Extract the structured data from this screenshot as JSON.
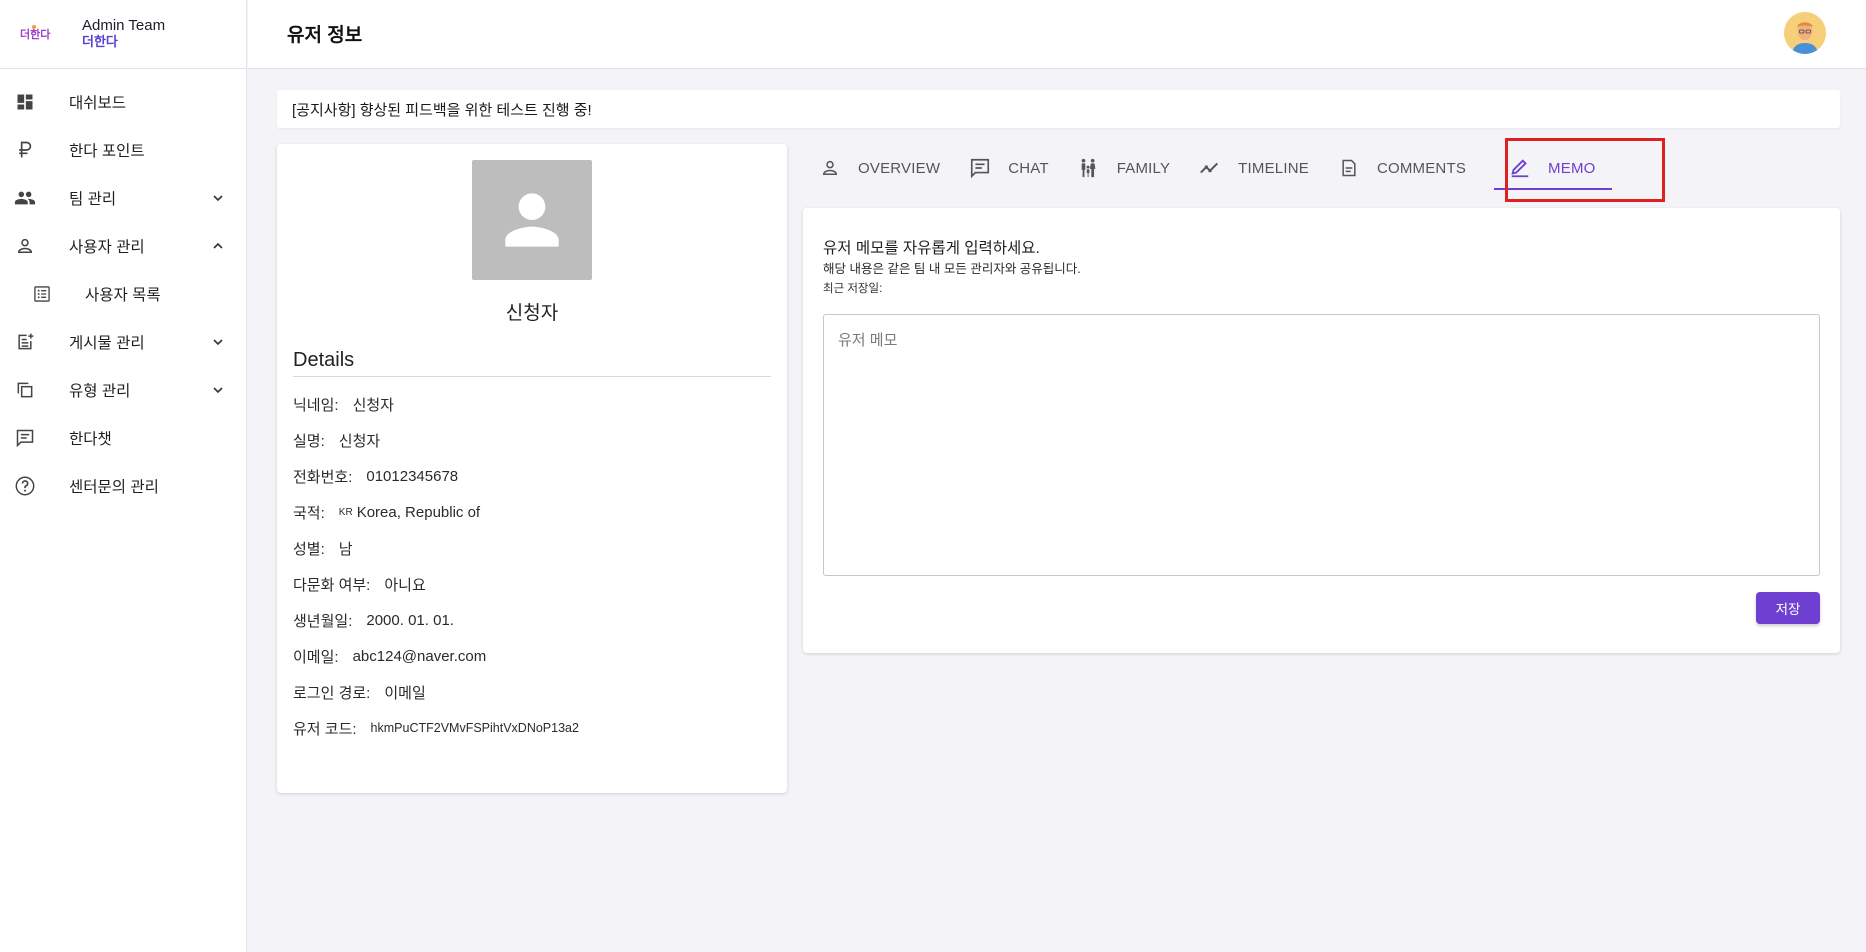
{
  "brand": {
    "logo_text": "더한다",
    "team": "Admin Team",
    "sub": "더한다"
  },
  "sidebar": {
    "items": [
      {
        "label": "대쉬보드",
        "icon": "dashboard-icon"
      },
      {
        "label": "한다 포인트",
        "icon": "ruble-icon"
      },
      {
        "label": "팀 관리",
        "icon": "group-icon",
        "chevron": "down"
      },
      {
        "label": "사용자 관리",
        "icon": "person-icon",
        "chevron": "up"
      },
      {
        "label": "사용자 목록",
        "icon": "list-alt-icon",
        "sub": true
      },
      {
        "label": "게시물 관리",
        "icon": "post-add-icon",
        "chevron": "down"
      },
      {
        "label": "유형 관리",
        "icon": "copy-icon",
        "chevron": "down"
      },
      {
        "label": "한다챗",
        "icon": "chat-icon"
      },
      {
        "label": "센터문의 관리",
        "icon": "help-icon"
      }
    ]
  },
  "header": {
    "title": "유저 정보"
  },
  "notice": {
    "text": "[공지사항] 향상된 피드백을 위한 테스트 진행 중!"
  },
  "profile": {
    "name": "신청자",
    "details_title": "Details",
    "fields": [
      {
        "label": "닉네임:",
        "value": "신청자"
      },
      {
        "label": "실명:",
        "value": "신청자"
      },
      {
        "label": "전화번호:",
        "value": "01012345678"
      },
      {
        "label": "국적:",
        "flag": "KR",
        "value": "Korea, Republic of"
      },
      {
        "label": "성별:",
        "value": "남"
      },
      {
        "label": "다문화 여부:",
        "value": "아니요"
      },
      {
        "label": "생년월일:",
        "value": "2000. 01. 01."
      },
      {
        "label": "이메일:",
        "value": "abc124@naver.com"
      },
      {
        "label": "로그인 경로:",
        "value": "이메일"
      },
      {
        "label": "유저 코드:",
        "value": "hkmPuCTF2VMvFSPihtVxDNoP13a2"
      }
    ]
  },
  "tabs": [
    {
      "label": "OVERVIEW",
      "icon": "person-outline-icon"
    },
    {
      "label": "CHAT",
      "icon": "chat-icon"
    },
    {
      "label": "FAMILY",
      "icon": "family-icon"
    },
    {
      "label": "TIMELINE",
      "icon": "timeline-icon"
    },
    {
      "label": "COMMENTS",
      "icon": "document-icon"
    },
    {
      "label": "MEMO",
      "icon": "edit-icon",
      "active": true
    }
  ],
  "memo": {
    "title": "유저 메모를 자유롭게 입력하세요.",
    "description": "해당 내용은 같은 팀 내 모든 관리자와 공유됩니다.",
    "last_saved": "최근 저장일:",
    "placeholder": "유저 메모",
    "value": "",
    "save_label": "저장"
  },
  "colors": {
    "accent": "#6e3fd0",
    "highlight": "#e02020",
    "avatar_placeholder": "#bdbdbd"
  }
}
